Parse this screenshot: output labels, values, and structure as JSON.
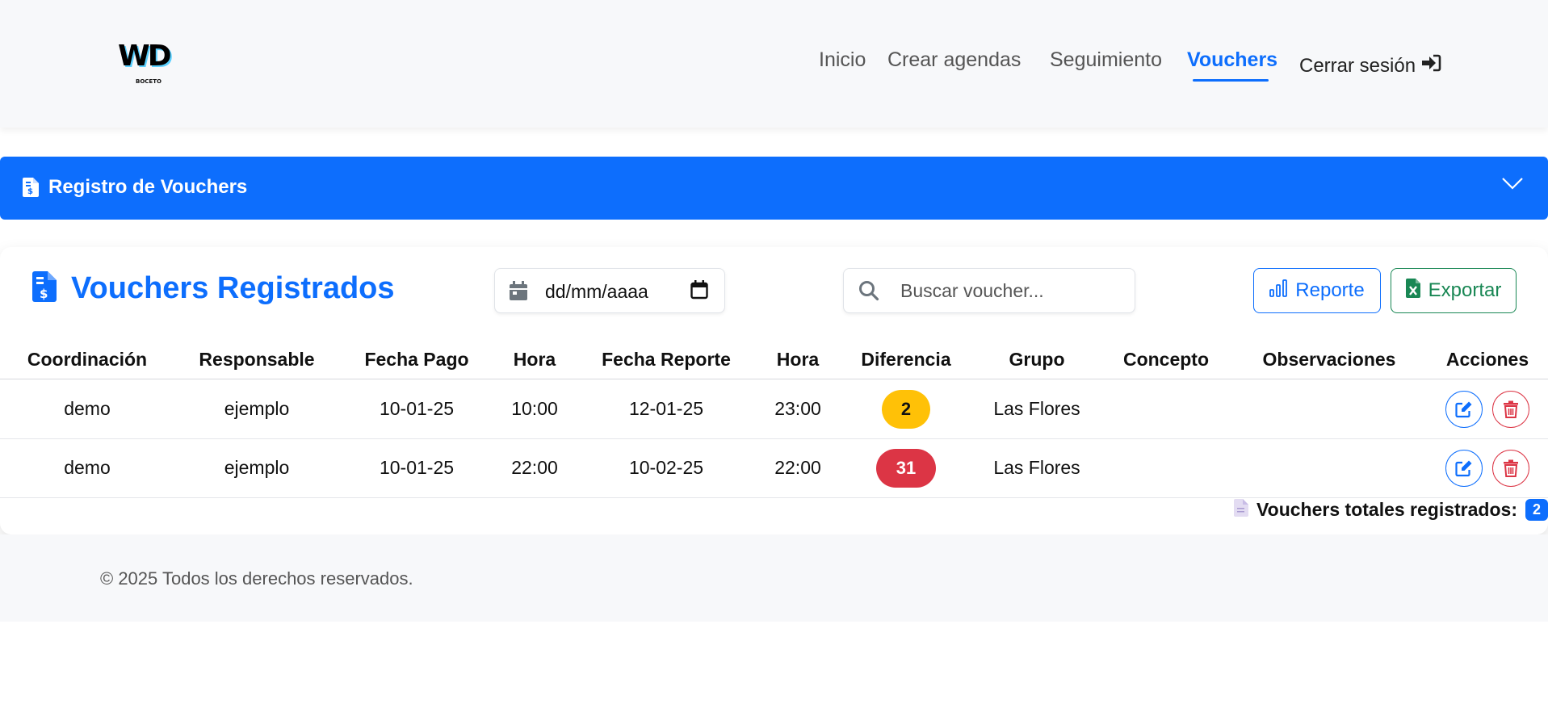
{
  "logo": {
    "mark": "WD",
    "sub": "BOCETO"
  },
  "nav": {
    "items": [
      {
        "label": "Inicio"
      },
      {
        "label": "Crear agendas"
      },
      {
        "label": "Seguimiento"
      },
      {
        "label": "Vouchers",
        "active": true
      }
    ],
    "logout_label": "Cerrar sesión"
  },
  "collapse": {
    "title": "Registro de Vouchers"
  },
  "card": {
    "title": "Vouchers Registrados",
    "date_placeholder": "dd/mm/aaaa",
    "search_placeholder": "Buscar voucher...",
    "report_label": "Reporte",
    "export_label": "Exportar"
  },
  "table": {
    "headers": [
      "Coordinación",
      "Responsable",
      "Fecha Pago",
      "Hora",
      "Fecha Reporte",
      "Hora",
      "Diferencia",
      "Grupo",
      "Concepto",
      "Observaciones",
      "Acciones"
    ],
    "rows": [
      {
        "coordinacion": "demo",
        "responsable": "ejemplo",
        "fecha_pago": "10-01-25",
        "hora_pago": "10:00",
        "fecha_reporte": "12-01-25",
        "hora_reporte": "23:00",
        "diferencia": "2",
        "diferencia_status": "warning",
        "grupo": "Las Flores",
        "concepto": "",
        "observaciones": ""
      },
      {
        "coordinacion": "demo",
        "responsable": "ejemplo",
        "fecha_pago": "10-01-25",
        "hora_pago": "22:00",
        "fecha_reporte": "10-02-25",
        "hora_reporte": "22:00",
        "diferencia": "31",
        "diferencia_status": "danger",
        "grupo": "Las Flores",
        "concepto": "",
        "observaciones": ""
      }
    ],
    "total_label": "Vouchers totales registrados:",
    "total_count": "2"
  },
  "footer": {
    "text": "© 2025 Todos los derechos reservados."
  },
  "colors": {
    "primary": "#0d6efd",
    "success": "#198754",
    "warning": "#ffc107",
    "danger": "#dc3545"
  },
  "icons": [
    "file-invoice-dollar-icon",
    "chevron-down-icon",
    "calendar-icon",
    "search-icon",
    "chart-bar-icon",
    "file-excel-icon",
    "edit-icon",
    "trash-icon",
    "sign-out-icon",
    "file-icon"
  ]
}
